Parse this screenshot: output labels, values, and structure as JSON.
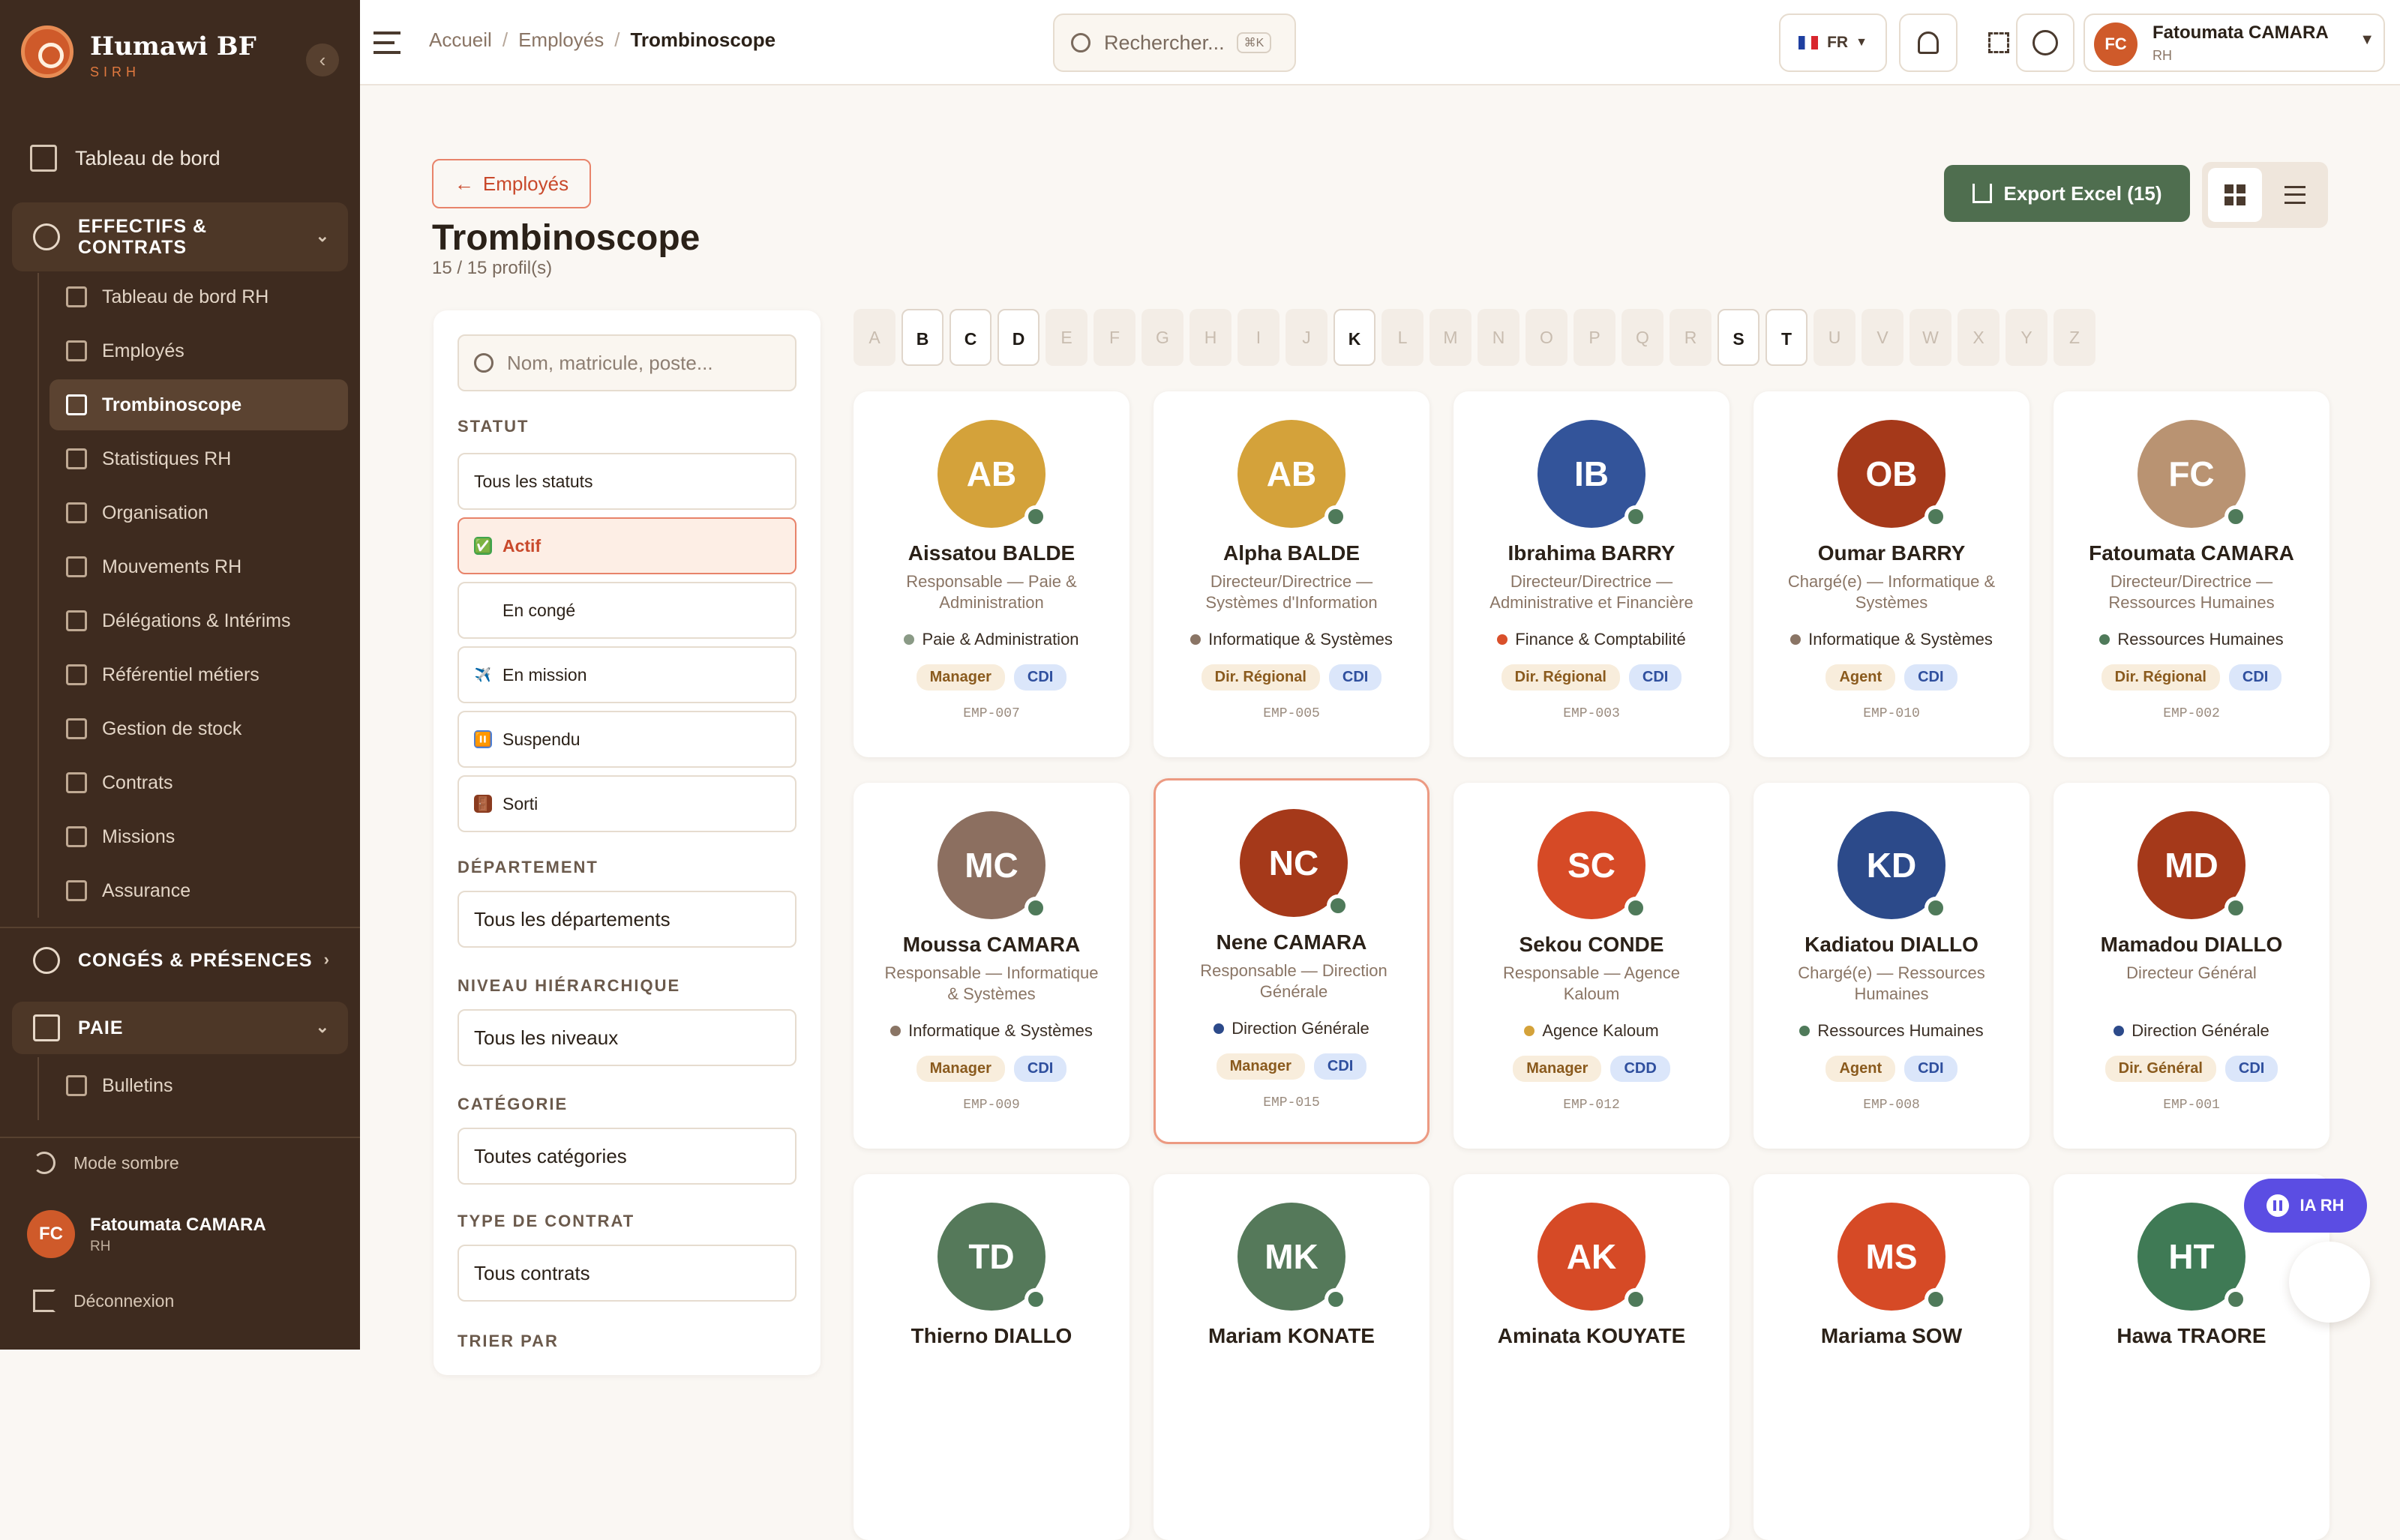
{
  "app": {
    "name": "Humawi BF",
    "subtitle": "SIRH"
  },
  "sidebar": {
    "dashboard": "Tableau de bord",
    "groups": [
      {
        "label": "EFFECTIFS & CONTRATS"
      },
      {
        "label": "CONGÉS & PRÉSENCES"
      },
      {
        "label": "PAIE"
      }
    ],
    "effectifs_items": [
      {
        "label": "Tableau de bord RH",
        "icon": "bar-chart-icon"
      },
      {
        "label": "Employés",
        "icon": "users-icon"
      },
      {
        "label": "Trombinoscope",
        "icon": "grid-icon"
      },
      {
        "label": "Statistiques RH",
        "icon": "trend-icon"
      },
      {
        "label": "Organisation",
        "icon": "building-icon"
      },
      {
        "label": "Mouvements RH",
        "icon": "refresh-icon"
      },
      {
        "label": "Délégations & Intérims",
        "icon": "swap-icon"
      },
      {
        "label": "Référentiel métiers",
        "icon": "bank-icon"
      },
      {
        "label": "Gestion de stock",
        "icon": "box-icon"
      },
      {
        "label": "Contrats",
        "icon": "document-icon"
      },
      {
        "label": "Missions",
        "icon": "plane-icon"
      },
      {
        "label": "Assurance",
        "icon": "heart-icon"
      }
    ],
    "paie_items": [
      {
        "label": "Bulletins",
        "icon": "receipt-icon"
      }
    ],
    "dark_mode": "Mode sombre",
    "user": {
      "initials": "FC",
      "name": "Fatoumata CAMARA",
      "role": "RH"
    },
    "logout": "Déconnexion"
  },
  "topbar": {
    "breadcrumb": [
      "Accueil",
      "Employés",
      "Trombinoscope"
    ],
    "search_placeholder": "Rechercher...",
    "search_shortcut": "⌘K",
    "lang": "FR",
    "user": {
      "initials": "FC",
      "name": "Fatoumata CAMARA",
      "role": "RH"
    }
  },
  "page": {
    "back_label": "Employés",
    "title": "Trombinoscope",
    "count": "15 / 15 profil(s)",
    "export_label": "Export Excel (15)"
  },
  "filters": {
    "search_placeholder": "Nom, matricule, poste...",
    "statut_label": "STATUT",
    "statut_options": [
      {
        "label": "Tous les statuts",
        "emoji": ""
      },
      {
        "label": "Actif",
        "emoji": "✅"
      },
      {
        "label": "En congé",
        "emoji": "🏝"
      },
      {
        "label": "En mission",
        "emoji": "✈️"
      },
      {
        "label": "Suspendu",
        "emoji": "⏸️"
      },
      {
        "label": "Sorti",
        "emoji": "🚪"
      }
    ],
    "departement_label": "DÉPARTEMENT",
    "departement_value": "Tous les départements",
    "niveau_label": "NIVEAU HIÉRARCHIQUE",
    "niveau_value": "Tous les niveaux",
    "categorie_label": "CATÉGORIE",
    "categorie_value": "Toutes catégories",
    "contrat_label": "TYPE DE CONTRAT",
    "contrat_value": "Tous contrats",
    "trier_label": "TRIER PAR"
  },
  "alphabet": [
    {
      "l": "A",
      "on": false
    },
    {
      "l": "B",
      "on": true
    },
    {
      "l": "C",
      "on": true
    },
    {
      "l": "D",
      "on": true
    },
    {
      "l": "E",
      "on": false
    },
    {
      "l": "F",
      "on": false
    },
    {
      "l": "G",
      "on": false
    },
    {
      "l": "H",
      "on": false
    },
    {
      "l": "I",
      "on": false
    },
    {
      "l": "J",
      "on": false
    },
    {
      "l": "K",
      "on": true
    },
    {
      "l": "L",
      "on": false
    },
    {
      "l": "M",
      "on": false
    },
    {
      "l": "N",
      "on": false
    },
    {
      "l": "O",
      "on": false
    },
    {
      "l": "P",
      "on": false
    },
    {
      "l": "Q",
      "on": false
    },
    {
      "l": "R",
      "on": false
    },
    {
      "l": "S",
      "on": true
    },
    {
      "l": "T",
      "on": true
    },
    {
      "l": "U",
      "on": false
    },
    {
      "l": "V",
      "on": false
    },
    {
      "l": "W",
      "on": false
    },
    {
      "l": "X",
      "on": false
    },
    {
      "l": "Y",
      "on": false
    },
    {
      "l": "Z",
      "on": false
    }
  ],
  "employees": [
    {
      "initials": "AB",
      "name": "Aissatou BALDE",
      "position": "Responsable — Paie & Administration",
      "dept": "Paie & Administration",
      "dept_color": "#8a9a86",
      "role": "Manager",
      "contract": "CDI",
      "matricule": "EMP-007",
      "color": "#d4a23a"
    },
    {
      "initials": "AB",
      "name": "Alpha BALDE",
      "position": "Directeur/Directrice — Systèmes d'Information",
      "dept": "Informatique & Systèmes",
      "dept_color": "#8a7565",
      "role": "Dir. Régional",
      "contract": "CDI",
      "matricule": "EMP-005",
      "color": "#d4a23a"
    },
    {
      "initials": "IB",
      "name": "Ibrahima BARRY",
      "position": "Directeur/Directrice — Administrative et Financière",
      "dept": "Finance & Comptabilité",
      "dept_color": "#d9502b",
      "role": "Dir. Régional",
      "contract": "CDI",
      "matricule": "EMP-003",
      "color": "#33549a"
    },
    {
      "initials": "OB",
      "name": "Oumar BARRY",
      "position": "Chargé(e) — Informatique & Systèmes",
      "dept": "Informatique & Systèmes",
      "dept_color": "#8a7565",
      "role": "Agent",
      "contract": "CDI",
      "matricule": "EMP-010",
      "color": "#a5391a"
    },
    {
      "initials": "FC",
      "name": "Fatoumata CAMARA",
      "position": "Directeur/Directrice — Ressources Humaines",
      "dept": "Ressources Humaines",
      "dept_color": "#4f7a5a",
      "role": "Dir. Régional",
      "contract": "CDI",
      "matricule": "EMP-002",
      "color": "#b99372"
    },
    {
      "initials": "MC",
      "name": "Moussa CAMARA",
      "position": "Responsable — Informatique & Systèmes",
      "dept": "Informatique & Systèmes",
      "dept_color": "#8a7565",
      "role": "Manager",
      "contract": "CDI",
      "matricule": "EMP-009",
      "color": "#8c6f60"
    },
    {
      "initials": "NC",
      "name": "Nene CAMARA",
      "position": "Responsable — Direction Générale",
      "dept": "Direction Générale",
      "dept_color": "#2c4a8a",
      "role": "Manager",
      "contract": "CDI",
      "matricule": "EMP-015",
      "color": "#a5391a"
    },
    {
      "initials": "SC",
      "name": "Sekou CONDE",
      "position": "Responsable — Agence Kaloum",
      "dept": "Agence Kaloum",
      "dept_color": "#d4a23a",
      "role": "Manager",
      "contract": "CDD",
      "matricule": "EMP-012",
      "color": "#d64a26"
    },
    {
      "initials": "KD",
      "name": "Kadiatou DIALLO",
      "position": "Chargé(e) — Ressources Humaines",
      "dept": "Ressources Humaines",
      "dept_color": "#4f7a5a",
      "role": "Agent",
      "contract": "CDI",
      "matricule": "EMP-008",
      "color": "#2c4a8a"
    },
    {
      "initials": "MD",
      "name": "Mamadou DIALLO",
      "position": "Directeur Général",
      "dept": "Direction Générale",
      "dept_color": "#2c4a8a",
      "role": "Dir. Général",
      "contract": "CDI",
      "matricule": "EMP-001",
      "color": "#a5391a"
    },
    {
      "initials": "TD",
      "name": "Thierno DIALLO",
      "position": "",
      "dept": "",
      "dept_color": "#4f7a5a",
      "role": "",
      "contract": "",
      "matricule": "",
      "color": "#55795a"
    },
    {
      "initials": "MK",
      "name": "Mariam KONATE",
      "position": "",
      "dept": "",
      "dept_color": "#4f7a5a",
      "role": "",
      "contract": "",
      "matricule": "",
      "color": "#55795a"
    },
    {
      "initials": "AK",
      "name": "Aminata KOUYATE",
      "position": "",
      "dept": "",
      "dept_color": "#4f7a5a",
      "role": "",
      "contract": "",
      "matricule": "",
      "color": "#d64a26"
    },
    {
      "initials": "MS",
      "name": "Mariama SOW",
      "position": "",
      "dept": "",
      "dept_color": "#4f7a5a",
      "role": "",
      "contract": "",
      "matricule": "",
      "color": "#d64a26"
    },
    {
      "initials": "HT",
      "name": "Hawa TRAORE",
      "position": "",
      "dept": "",
      "dept_color": "#4f7a5a",
      "role": "",
      "contract": "",
      "matricule": "",
      "color": "#3f7a55"
    }
  ],
  "assistant_label": "IA RH"
}
